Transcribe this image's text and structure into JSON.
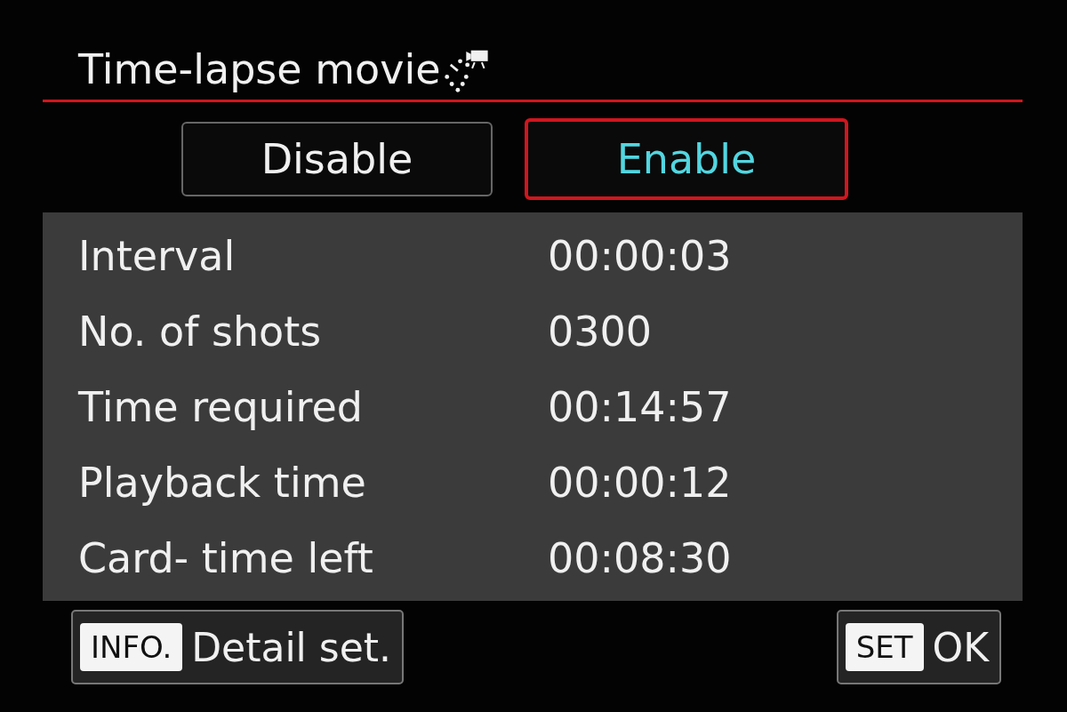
{
  "title": "Time-lapse movie",
  "options": [
    {
      "label": "Disable",
      "selected": false
    },
    {
      "label": "Enable",
      "selected": true
    }
  ],
  "settings": [
    {
      "label": "Interval",
      "value": "00:00:03"
    },
    {
      "label": "No. of shots",
      "value": "0300"
    },
    {
      "label": "Time required",
      "value": "00:14:57"
    },
    {
      "label": "Playback time",
      "value": "00:00:12"
    },
    {
      "label": "Card- time left",
      "value": "00:08:30"
    }
  ],
  "footer": [
    {
      "key": "INFO.",
      "label": "Detail set."
    },
    {
      "key": "SET",
      "label": "OK"
    }
  ]
}
